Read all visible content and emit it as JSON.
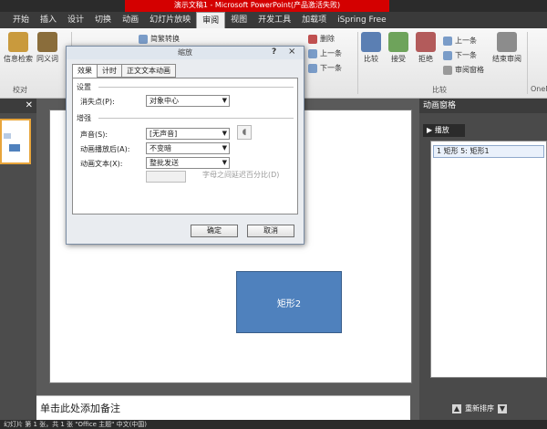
{
  "window": {
    "title": "演示文稿1 - Microsoft PowerPoint(产品激活失败)"
  },
  "ribbon_tabs": [
    "开始",
    "插入",
    "设计",
    "切换",
    "动画",
    "幻灯片放映",
    "审阅",
    "视图",
    "开发工具",
    "加载项",
    "iSpring Free"
  ],
  "active_tab": "审阅",
  "ribbon": {
    "proofing": {
      "research": "信息检索",
      "thesaurus": "同义词",
      "group_label": "校对"
    },
    "simplified": "简繁转换",
    "compare": {
      "compare": "比较",
      "accept": "接受",
      "reject": "拒绝",
      "previous": "上一条",
      "next": "下一条",
      "delete": "删除",
      "prev2": "上一条",
      "next2": "下一条",
      "reviewing_pane": "审阅窗格",
      "end_review": "结束审阅",
      "group_label": "比较"
    },
    "onenote": "OneN"
  },
  "dialog": {
    "title": "缩放",
    "help": "?",
    "close": "×",
    "tabs": [
      "效果",
      "计时",
      "正文文本动画"
    ],
    "section_settings": "设置",
    "vanishing_point_label": "消失点(P):",
    "vanishing_point_value": "对象中心",
    "section_enhance": "增强",
    "sound_label": "声音(S):",
    "sound_value": "[无声音]",
    "after_anim_label": "动画播放后(A):",
    "after_anim_value": "不变暗",
    "animate_text_label": "动画文本(X):",
    "animate_text_value": "整批发送",
    "delay_between_letters": "字母之间延迟百分比(D)",
    "ok": "确定",
    "cancel": "取消"
  },
  "slide": {
    "shape_label": "矩形2"
  },
  "notes_placeholder": "单击此处添加备注",
  "animation_pane": {
    "title": "动画窗格",
    "play": "▶ 播放",
    "item": "1  矩形 5: 矩形1",
    "reorder": "重新排序"
  },
  "statusbar": "幻灯片 第 1 张，共 1 张   \"Office 主题\"   中文(中国)"
}
